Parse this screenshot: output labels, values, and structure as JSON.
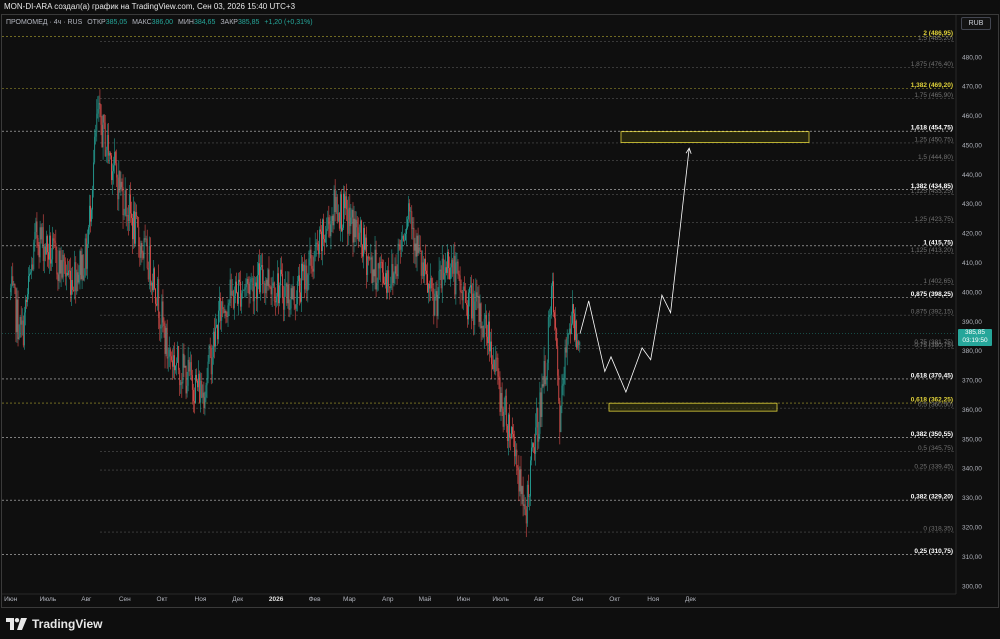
{
  "header": {
    "title": "MON-DI-ARA создал(а) график на TradingView.com, Сен 03, 2026 15:40 UTC+3"
  },
  "legend": {
    "symbol": "ПРОМОМЕД · 4ч · RUS",
    "open_label": "ОТКР",
    "open_value": "385,05",
    "high_label": "МАКС",
    "high_value": "386,00",
    "low_label": "МИН",
    "low_value": "384,65",
    "close_label": "ЗАКР",
    "close_value": "385,85",
    "change": "+1,20 (+0,31%)"
  },
  "currency_button": "RUB",
  "price_badge": {
    "price": "385,85",
    "countdown": "03:19:50"
  },
  "footer": {
    "logo_text": "TradingView"
  },
  "colors": {
    "background": "#0f0f0f",
    "bull": "#26a69a",
    "bear": "#ef5350",
    "fib_yellow": "#e0d23a",
    "fib_grey": "#8a8a8a",
    "fib_white": "#ffffff",
    "zone_fill": "#3a3a10",
    "projection": "#ffffff"
  },
  "chart_data": {
    "type": "candlestick",
    "x_ticks": [
      "Июн",
      "Июль",
      "Авг",
      "Сен",
      "Окт",
      "Ноя",
      "Дек",
      "2026",
      "Фев",
      "Мар",
      "Апр",
      "Май",
      "Июн",
      "Июль",
      "Авг",
      "Сен",
      "Окт",
      "Ноя",
      "Дек"
    ],
    "x_tick_bold": [
      "2026"
    ],
    "y_ticks": [
      480,
      470,
      460,
      450,
      440,
      430,
      420,
      410,
      400,
      390,
      380,
      370,
      360,
      350,
      340,
      330,
      320,
      310,
      300
    ],
    "y_tick_labels": [
      "480,00",
      "470,00",
      "460,00",
      "450,00",
      "440,00",
      "430,00",
      "420,00",
      "410,00",
      "400,00",
      "390,00",
      "380,00",
      "370,00",
      "360,00",
      "350,00",
      "340,00",
      "330,00",
      "320,00",
      "310,00",
      "300,00"
    ],
    "ylim": [
      296,
      492
    ],
    "current_price": 385.85,
    "fib_levels": [
      {
        "label": "2 (486,95)",
        "price": 486.95,
        "style": "yellow"
      },
      {
        "label": "1,5 (485,20)",
        "price": 485.2,
        "style": "grey"
      },
      {
        "label": "1,875 (476,40)",
        "price": 476.4,
        "style": "grey"
      },
      {
        "label": "1,382 (469,20)",
        "price": 469.2,
        "style": "yellow"
      },
      {
        "label": "1,75 (465,90)",
        "price": 465.9,
        "style": "grey"
      },
      {
        "label": "1,618 (454,75)",
        "price": 454.75,
        "style": "white"
      },
      {
        "label": "1,25 (450,75)",
        "price": 450.75,
        "style": "grey"
      },
      {
        "label": "1,5 (444,80)",
        "price": 444.8,
        "style": "grey"
      },
      {
        "label": "1,382 (434,85)",
        "price": 434.85,
        "style": "white"
      },
      {
        "label": "1,125 (433,25)",
        "price": 433.25,
        "style": "grey"
      },
      {
        "label": "1,25 (423,75)",
        "price": 423.75,
        "style": "grey"
      },
      {
        "label": "1 (415,75)",
        "price": 415.75,
        "style": "white"
      },
      {
        "label": "1,125 (413,20)",
        "price": 413.2,
        "style": "grey"
      },
      {
        "label": "1 (402,65)",
        "price": 402.65,
        "style": "grey"
      },
      {
        "label": "0,875 (398,25)",
        "price": 398.25,
        "style": "white"
      },
      {
        "label": "0,875 (392,15)",
        "price": 392.15,
        "style": "grey"
      },
      {
        "label": "0,75 (381,75)",
        "price": 381.75,
        "style": "grey"
      },
      {
        "label": "0,75 (380,75)",
        "price": 380.75,
        "style": "grey"
      },
      {
        "label": "0,618 (370,45)",
        "price": 370.45,
        "style": "white"
      },
      {
        "label": "0,618 (362,25)",
        "price": 362.25,
        "style": "yellow"
      },
      {
        "label": "0,5 (360,50)",
        "price": 360.5,
        "style": "grey"
      },
      {
        "label": "0,382 (350,55)",
        "price": 350.55,
        "style": "white"
      },
      {
        "label": "0,5 (345,75)",
        "price": 345.75,
        "style": "grey"
      },
      {
        "label": "0,25 (339,45)",
        "price": 339.45,
        "style": "grey"
      },
      {
        "label": "0,382 (329,20)",
        "price": 329.2,
        "style": "white"
      },
      {
        "label": "0 (318,35)",
        "price": 318.35,
        "style": "grey"
      },
      {
        "label": "0,25 (310,75)",
        "price": 310.75,
        "style": "white"
      }
    ],
    "zones": [
      {
        "name": "target-zone",
        "price_low": 450.9,
        "price_high": 454.6
      },
      {
        "name": "support-zone",
        "price_low": 359.5,
        "price_high": 362.2
      }
    ],
    "price_path": [
      {
        "date": "2025-06-01",
        "price": 400
      },
      {
        "date": "2025-06-10",
        "price": 385
      },
      {
        "date": "2025-06-22",
        "price": 420
      },
      {
        "date": "2025-07-05",
        "price": 412
      },
      {
        "date": "2025-07-20",
        "price": 405
      },
      {
        "date": "2025-08-01",
        "price": 412
      },
      {
        "date": "2025-08-10",
        "price": 460
      },
      {
        "date": "2025-08-25",
        "price": 440
      },
      {
        "date": "2025-09-10",
        "price": 420
      },
      {
        "date": "2025-09-25",
        "price": 405
      },
      {
        "date": "2025-10-05",
        "price": 380
      },
      {
        "date": "2025-10-20",
        "price": 372
      },
      {
        "date": "2025-11-03",
        "price": 366
      },
      {
        "date": "2025-11-18",
        "price": 395
      },
      {
        "date": "2025-12-05",
        "price": 402
      },
      {
        "date": "2025-12-25",
        "price": 405
      },
      {
        "date": "2026-01-15",
        "price": 398
      },
      {
        "date": "2026-02-05",
        "price": 415
      },
      {
        "date": "2026-02-18",
        "price": 430
      },
      {
        "date": "2026-03-05",
        "price": 422
      },
      {
        "date": "2026-03-20",
        "price": 408
      },
      {
        "date": "2026-04-05",
        "price": 405
      },
      {
        "date": "2026-04-18",
        "price": 430
      },
      {
        "date": "2026-04-28",
        "price": 408
      },
      {
        "date": "2026-05-08",
        "price": 395
      },
      {
        "date": "2026-05-20",
        "price": 412
      },
      {
        "date": "2026-05-30",
        "price": 400
      },
      {
        "date": "2026-06-10",
        "price": 395
      },
      {
        "date": "2026-06-22",
        "price": 385
      },
      {
        "date": "2026-07-03",
        "price": 360
      },
      {
        "date": "2026-07-12",
        "price": 350
      },
      {
        "date": "2026-07-20",
        "price": 322
      },
      {
        "date": "2026-07-28",
        "price": 348
      },
      {
        "date": "2026-08-05",
        "price": 370
      },
      {
        "date": "2026-08-12",
        "price": 400
      },
      {
        "date": "2026-08-18",
        "price": 355
      },
      {
        "date": "2026-08-25",
        "price": 392
      },
      {
        "date": "2026-09-03",
        "price": 385.85
      }
    ],
    "projection": [
      {
        "date": "2026-09-05",
        "price": 389
      },
      {
        "date": "2026-09-10",
        "price": 397
      },
      {
        "date": "2026-09-23",
        "price": 373
      },
      {
        "date": "2026-09-28",
        "price": 378
      },
      {
        "date": "2026-10-10",
        "price": 366
      },
      {
        "date": "2026-10-23",
        "price": 381
      },
      {
        "date": "2026-10-30",
        "price": 377
      },
      {
        "date": "2026-11-08",
        "price": 399
      },
      {
        "date": "2026-11-15",
        "price": 393
      },
      {
        "date": "2026-11-30",
        "price": 449
      }
    ]
  }
}
